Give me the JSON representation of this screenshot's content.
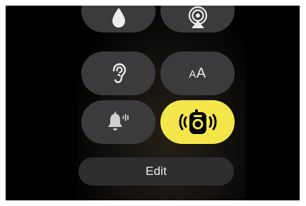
{
  "controls": [
    {
      "id": "water-lock",
      "icon": "water-drop-icon",
      "active": false
    },
    {
      "id": "airplay",
      "icon": "airplay-audio-icon",
      "active": false
    },
    {
      "id": "hearing",
      "icon": "ear-icon",
      "active": false
    },
    {
      "id": "text-size",
      "icon": "text-size-icon",
      "label": "AA",
      "label_small": "A",
      "label_large": "A",
      "active": false
    },
    {
      "id": "silent-mode",
      "icon": "bell-silent-icon",
      "active": false
    },
    {
      "id": "walkie-talkie",
      "icon": "walkie-talkie-icon",
      "active": true
    }
  ],
  "edit_button": {
    "label": "Edit"
  },
  "colors": {
    "tile": "#3b3b3d",
    "active_tile": "#f4e64a",
    "icon": "#ededed",
    "icon_dim": "#cfcfcf",
    "active_icon": "#000000",
    "background": "#000000"
  }
}
